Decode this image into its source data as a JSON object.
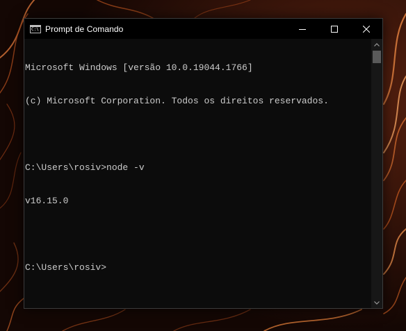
{
  "window": {
    "title": "Prompt de Comando",
    "app_icon_text": "C:\\",
    "icons": {
      "app": "cmd-icon",
      "minimize": "minimize-icon",
      "maximize": "maximize-icon",
      "close": "close-icon",
      "scroll_up": "chevron-up-icon",
      "scroll_down": "chevron-down-icon"
    }
  },
  "console": {
    "lines": [
      "Microsoft Windows [versão 10.0.19044.1766]",
      "(c) Microsoft Corporation. Todos os direitos reservados.",
      "",
      "C:\\Users\\rosiv>node -v",
      "v16.15.0",
      "",
      "C:\\Users\\rosiv>"
    ]
  },
  "colors": {
    "console_bg": "#0c0c0c",
    "console_text": "#cccccc",
    "titlebar_bg": "#000000",
    "wallpaper_accent": "#c0521e"
  }
}
